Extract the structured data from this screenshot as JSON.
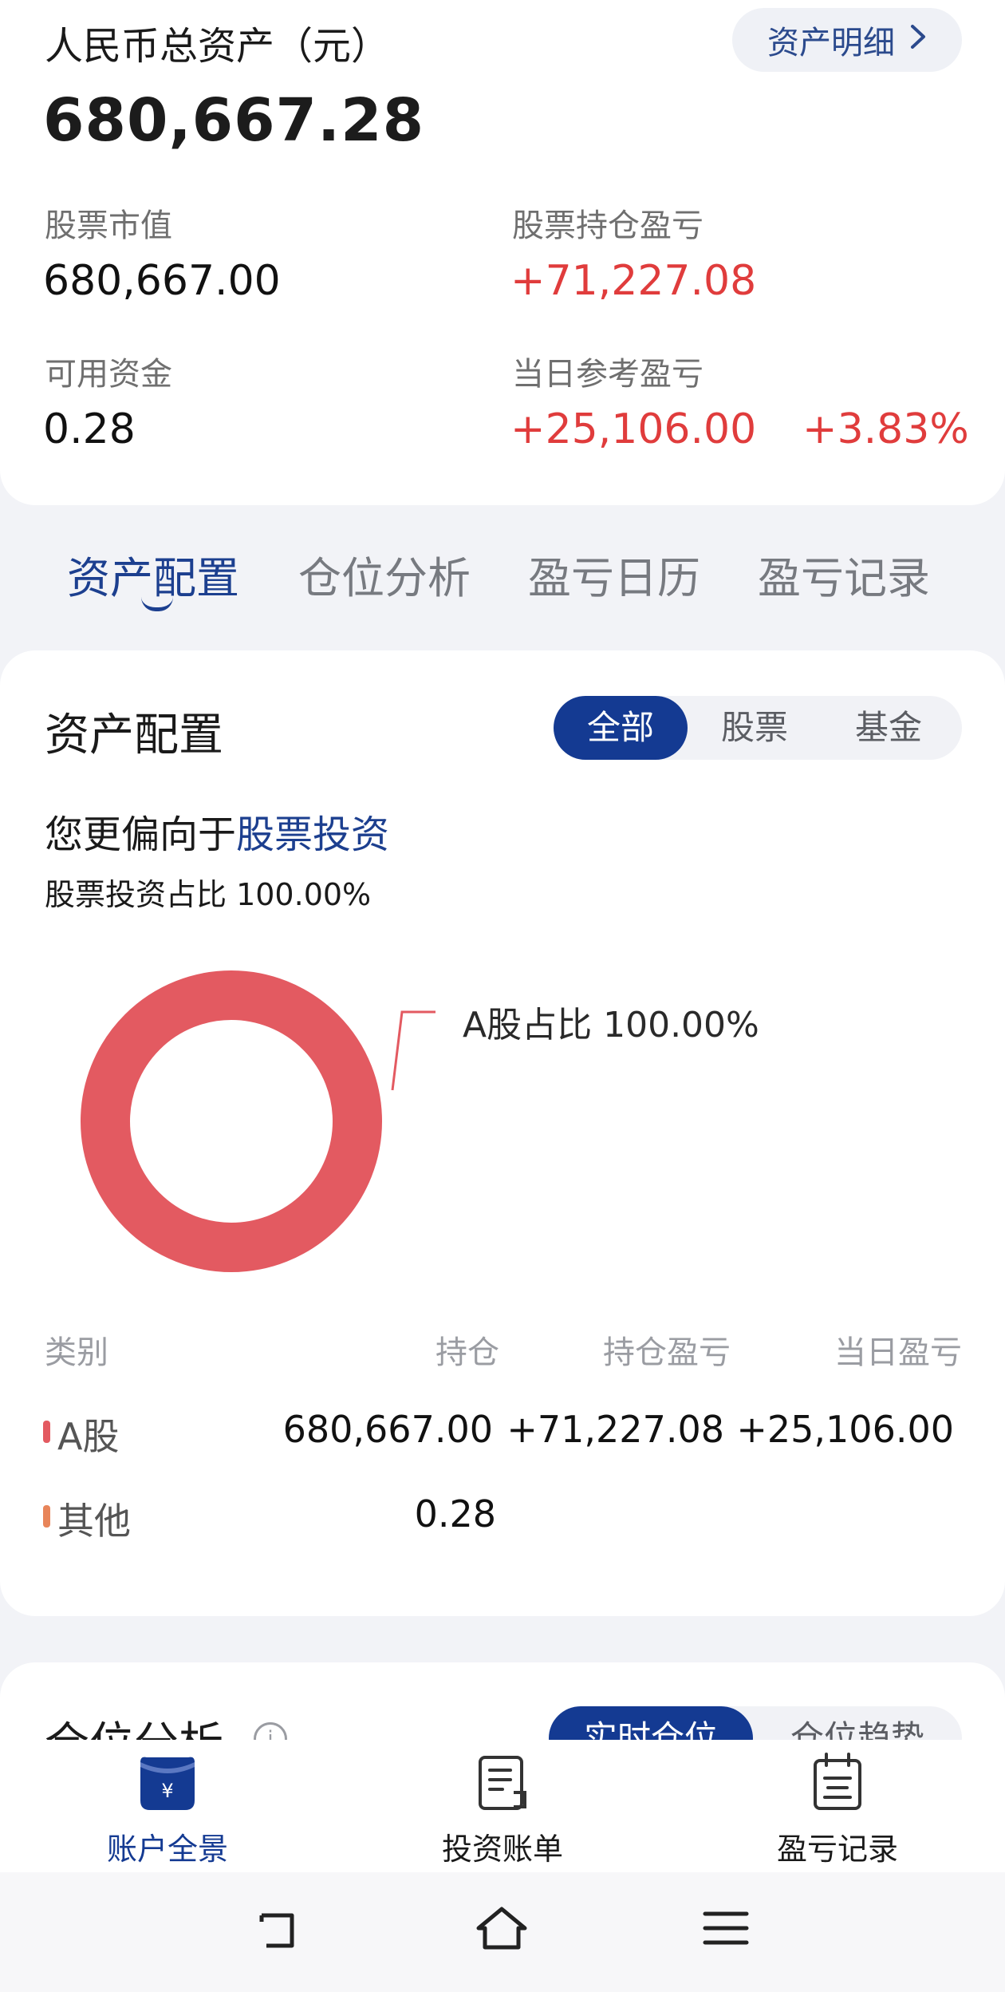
{
  "summary": {
    "title": "人民币总资产（元）",
    "detail_button": "资产明细",
    "total_value": "680,667.28",
    "stock_value_label": "股票市值",
    "stock_value": "680,667.00",
    "holding_pnl_label": "股票持仓盈亏",
    "holding_pnl": "+71,227.08",
    "available_cash_label": "可用资金",
    "available_cash": "0.28",
    "daily_pnl_label": "当日参考盈亏",
    "daily_pnl": "+25,106.00",
    "daily_pnl_pct": "+3.83%"
  },
  "tabs": [
    "资产配置",
    "仓位分析",
    "盈亏日历",
    "盈亏记录"
  ],
  "allocation": {
    "title": "资产配置",
    "filters": [
      "全部",
      "股票",
      "基金"
    ],
    "prefer_prefix": "您更偏向于",
    "prefer_type": "股票投资",
    "ratio_text": "股票投资占比 100.00%",
    "table_headers": [
      "类别",
      "持仓",
      "持仓盈亏",
      "当日盈亏"
    ],
    "rows": [
      {
        "category": "A股",
        "holding": "680,667.00",
        "holding_pnl": "+71,227.08",
        "daily_pnl": "+25,106.00"
      },
      {
        "category": "其他",
        "holding": "0.28",
        "holding_pnl": "",
        "daily_pnl": ""
      }
    ]
  },
  "chart_data": {
    "type": "pie",
    "categories": [
      "A股"
    ],
    "values": [
      100.0
    ],
    "annotations": [
      "A股占比 100.00%"
    ],
    "colors": [
      "#e35a61"
    ]
  },
  "position": {
    "title": "仓位分析",
    "filters": [
      "实时仓位",
      "仓位趋势"
    ]
  },
  "bottom_nav": [
    {
      "label": "账户全景",
      "icon": "wallet-yuan-icon"
    },
    {
      "label": "投资账单",
      "icon": "bill-icon"
    },
    {
      "label": "盈亏记录",
      "icon": "calendar-record-icon"
    }
  ],
  "colors": {
    "accent": "#143a92",
    "gain": "#e03c3c",
    "chart": "#e35a61",
    "other": "#e8855a"
  }
}
